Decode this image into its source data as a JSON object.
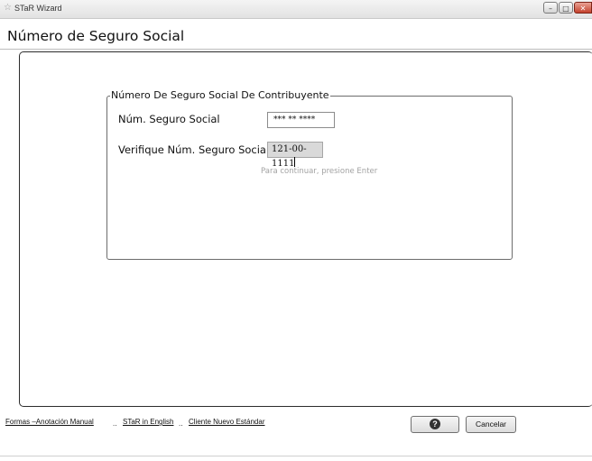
{
  "window": {
    "title": "STaR Wizard",
    "minimize_glyph": "–",
    "maximize_glyph": "□",
    "close_glyph": "✕"
  },
  "page": {
    "title": "Número de Seguro Social"
  },
  "group": {
    "legend": "Número De Seguro Social De Contribuyente",
    "ssn_label": "Núm. Seguro Social",
    "ssn_value": "*** ** ****",
    "verify_label": "Verifique Núm. Seguro Social",
    "verify_value": "121-00-1111",
    "hint": "Para continuar, presione Enter"
  },
  "footer": {
    "links": [
      "Formas –Anotación Manual",
      "STaR in English",
      "Cliente Nuevo Estándar"
    ],
    "separator": "..",
    "help_glyph": "?",
    "cancel_label": "Cancelar"
  },
  "icons": {
    "app": "star-icon",
    "help": "question-icon"
  }
}
